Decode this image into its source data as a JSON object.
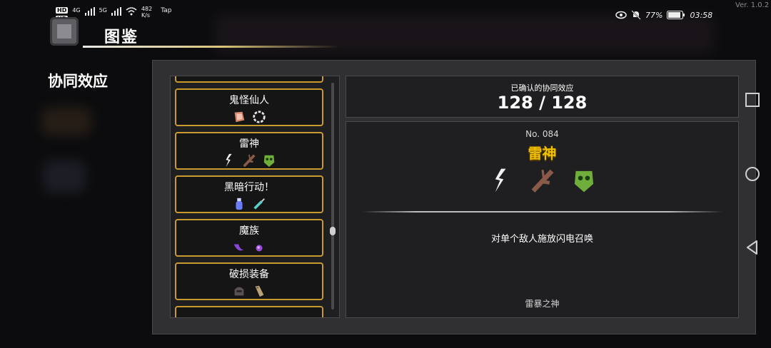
{
  "status_bar": {
    "hd1": "HD",
    "hd2": "HD",
    "net1": "4G",
    "net2": "5G",
    "speed_value": "482",
    "speed_unit": "K/s",
    "app_label": "Tap",
    "battery": "77%",
    "time": "03:58"
  },
  "version": "Ver. 1.0.2",
  "header": {
    "title": "图鉴",
    "section_label": "协同效应"
  },
  "list": {
    "items": [
      {
        "name": "",
        "icons": [
          "sword-icon",
          "web-icon",
          "dagger-icon",
          "claw-icon"
        ]
      },
      {
        "name": "鬼怪仙人",
        "icons": [
          "meat-icon",
          "chain-icon"
        ]
      },
      {
        "name": "雷神",
        "icons": [
          "lightning-icon",
          "branch-icon",
          "mask-icon"
        ]
      },
      {
        "name": "黑暗行动！",
        "icons": [
          "potion-icon",
          "syringe-icon"
        ]
      },
      {
        "name": "魔族",
        "icons": [
          "tentacle-icon",
          "orb-icon"
        ]
      },
      {
        "name": "破损装备",
        "icons": [
          "helmet-icon",
          "gauntlet-icon"
        ]
      },
      {
        "name": "",
        "icons": []
      }
    ],
    "scroll_fraction": 0.66
  },
  "summary": {
    "label": "已确认的协同效应",
    "count": "128 / 128"
  },
  "detail": {
    "number": "No. 084",
    "name": "雷神",
    "icons": [
      "lightning-icon",
      "branch-icon",
      "mask-icon"
    ],
    "description": "对单个敌人施放闪电召唤",
    "flavor": "雷暴之神"
  },
  "colors": {
    "card_border": "#c99a2e",
    "detail_title": "#f2c200",
    "panel_bg": "#303033"
  }
}
